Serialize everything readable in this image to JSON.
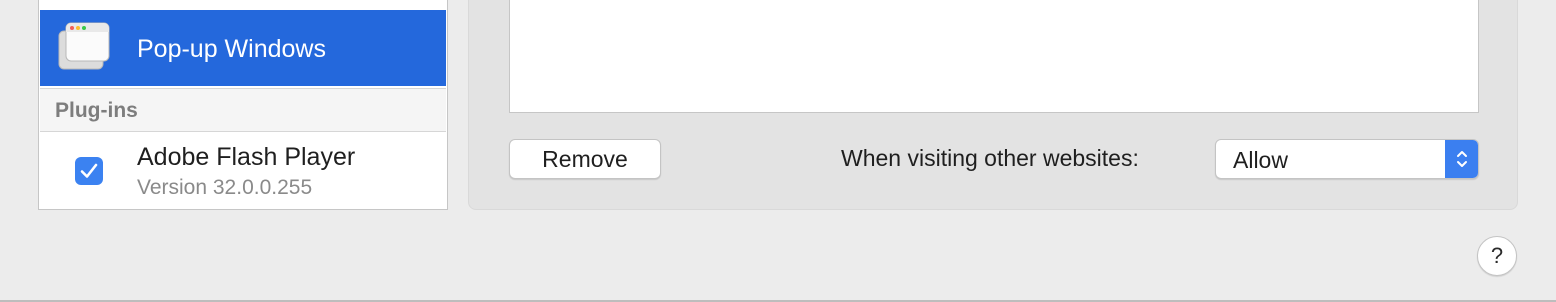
{
  "sidebar": {
    "selected_item": {
      "label": "Pop-up Windows",
      "icon": "popup-window-icon"
    },
    "section_header": "Plug-ins",
    "plugins": [
      {
        "name": "Adobe Flash Player",
        "version": "Version 32.0.0.255",
        "enabled": true
      }
    ]
  },
  "panel": {
    "remove_label": "Remove",
    "visiting_label": "When visiting other websites:",
    "visiting_value": "Allow"
  },
  "help": {
    "label": "?"
  },
  "colors": {
    "selection": "#2468dc",
    "checkbox": "#3b82f1",
    "stepper": "#3b7ff0"
  }
}
